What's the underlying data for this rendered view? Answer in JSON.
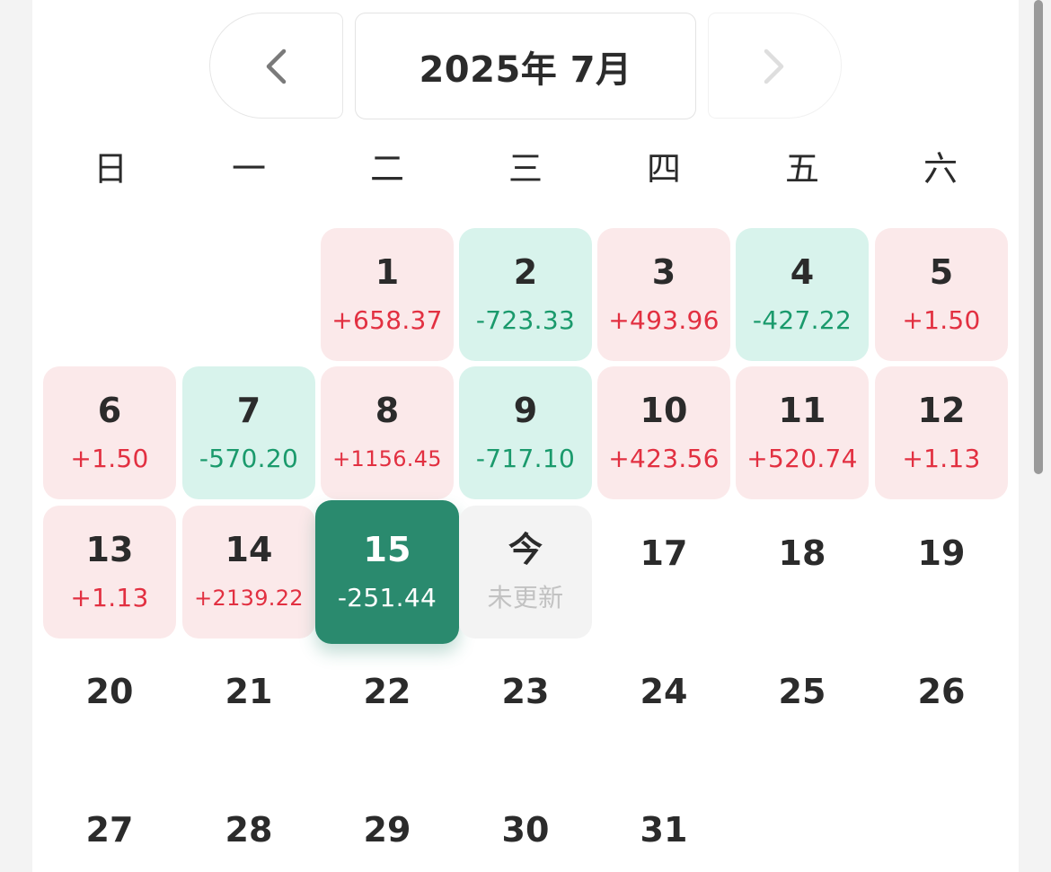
{
  "header": {
    "month_label": "2025年 7月"
  },
  "weekdays": [
    "日",
    "一",
    "二",
    "三",
    "四",
    "五",
    "六"
  ],
  "colors": {
    "gain": "#e23041",
    "loss": "#1a9a6c",
    "gain_bg": "#fbe9ea",
    "loss_bg": "#d8f3ec",
    "selected_bg": "#2a8a6e"
  },
  "days": [
    {
      "day": "1",
      "pnl": "+658.37",
      "status": "gain"
    },
    {
      "day": "2",
      "pnl": "-723.33",
      "status": "loss"
    },
    {
      "day": "3",
      "pnl": "+493.96",
      "status": "gain"
    },
    {
      "day": "4",
      "pnl": "-427.22",
      "status": "loss"
    },
    {
      "day": "5",
      "pnl": "+1.50",
      "status": "gain"
    },
    {
      "day": "6",
      "pnl": "+1.50",
      "status": "gain"
    },
    {
      "day": "7",
      "pnl": "-570.20",
      "status": "loss"
    },
    {
      "day": "8",
      "pnl": "+1156.45",
      "status": "gain"
    },
    {
      "day": "9",
      "pnl": "-717.10",
      "status": "loss"
    },
    {
      "day": "10",
      "pnl": "+423.56",
      "status": "gain"
    },
    {
      "day": "11",
      "pnl": "+520.74",
      "status": "gain"
    },
    {
      "day": "12",
      "pnl": "+1.13",
      "status": "gain"
    },
    {
      "day": "13",
      "pnl": "+1.13",
      "status": "gain"
    },
    {
      "day": "14",
      "pnl": "+2139.22",
      "status": "gain"
    },
    {
      "day": "15",
      "pnl": "-251.44",
      "status": "selected"
    },
    {
      "day": "今",
      "pnl": "未更新",
      "status": "today"
    },
    {
      "day": "17",
      "pnl": "",
      "status": "plain"
    },
    {
      "day": "18",
      "pnl": "",
      "status": "plain"
    },
    {
      "day": "19",
      "pnl": "",
      "status": "plain"
    },
    {
      "day": "20",
      "pnl": "",
      "status": "plain"
    },
    {
      "day": "21",
      "pnl": "",
      "status": "plain"
    },
    {
      "day": "22",
      "pnl": "",
      "status": "plain"
    },
    {
      "day": "23",
      "pnl": "",
      "status": "plain"
    },
    {
      "day": "24",
      "pnl": "",
      "status": "plain"
    },
    {
      "day": "25",
      "pnl": "",
      "status": "plain"
    },
    {
      "day": "26",
      "pnl": "",
      "status": "plain"
    },
    {
      "day": "27",
      "pnl": "",
      "status": "plain"
    },
    {
      "day": "28",
      "pnl": "",
      "status": "plain"
    },
    {
      "day": "29",
      "pnl": "",
      "status": "plain"
    },
    {
      "day": "30",
      "pnl": "",
      "status": "plain"
    },
    {
      "day": "31",
      "pnl": "",
      "status": "plain"
    }
  ]
}
